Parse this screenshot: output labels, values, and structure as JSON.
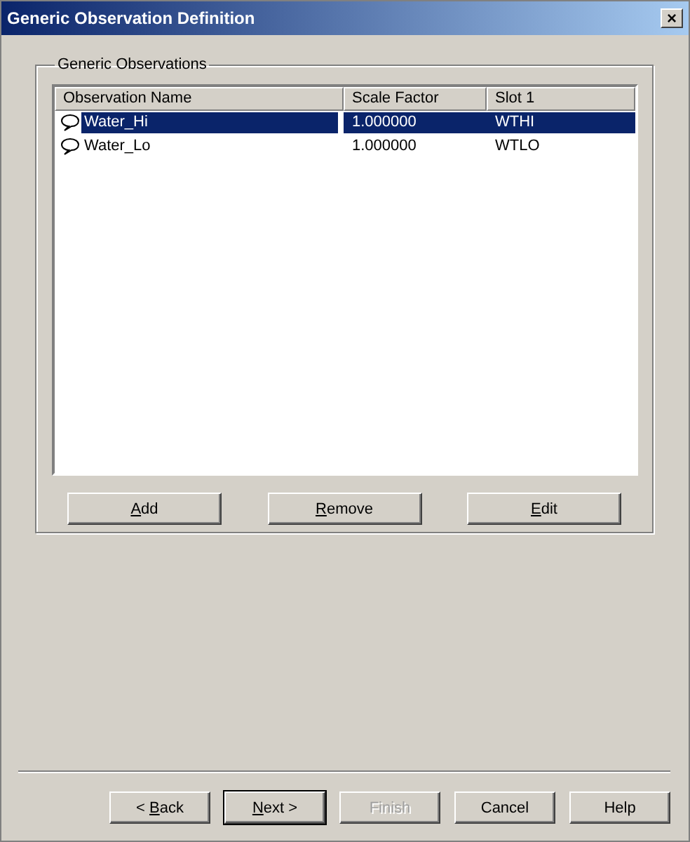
{
  "window": {
    "title": "Generic Observation Definition",
    "close": "×"
  },
  "group": {
    "label": "Generic Observations"
  },
  "table": {
    "columns": [
      "Observation Name",
      "Scale Factor",
      "Slot 1"
    ],
    "rows": [
      {
        "cells": [
          "Water_Hi",
          "1.000000",
          "WTHI"
        ],
        "selected": true
      },
      {
        "cells": [
          "Water_Lo",
          "1.000000",
          "WTLO"
        ],
        "selected": false
      }
    ]
  },
  "list_buttons": [
    {
      "access_key": "A",
      "after_key": "dd",
      "disabled": false,
      "default": false
    },
    {
      "access_key": "R",
      "after_key": "emove",
      "disabled": false,
      "default": false
    },
    {
      "access_key": "E",
      "after_key": "dit",
      "disabled": false,
      "default": false
    }
  ],
  "wizard_buttons": [
    {
      "before_key": "< ",
      "access_key": "B",
      "after_key": "ack",
      "disabled": false,
      "default": false
    },
    {
      "access_key": "N",
      "after_key": "ext >",
      "disabled": false,
      "default": true
    },
    {
      "label": "Finish",
      "disabled": true,
      "default": false
    },
    {
      "label": "Cancel",
      "disabled": false,
      "default": false
    },
    {
      "label": "Help",
      "disabled": false,
      "default": false
    }
  ]
}
